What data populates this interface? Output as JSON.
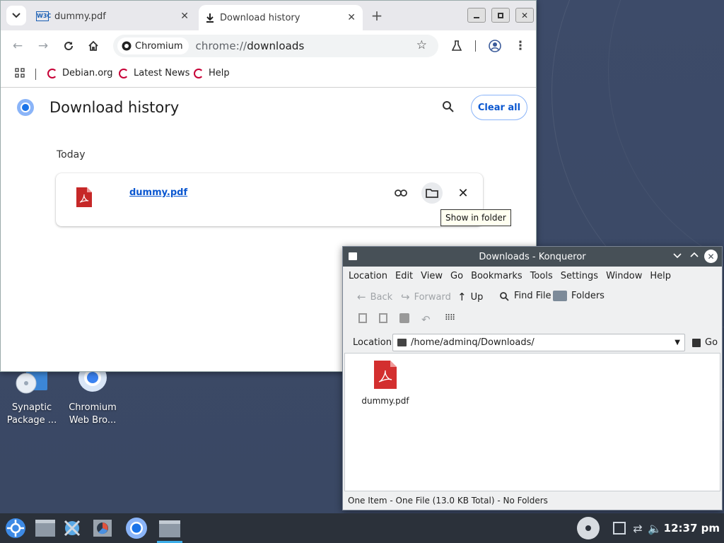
{
  "chrome": {
    "tabs": [
      {
        "label": "dummy.pdf",
        "favicon": "w3c-icon"
      },
      {
        "label": "Download history",
        "favicon": "download-icon"
      }
    ],
    "omnibox": {
      "chip": "Chromium",
      "url_scheme": "chrome://",
      "url_path": "downloads"
    },
    "bookmarks": [
      "Debian.org",
      "Latest News",
      "Help"
    ],
    "page": {
      "title": "Download history",
      "clear_all": "Clear all",
      "section": "Today",
      "item": {
        "filename": "dummy.pdf"
      },
      "tooltip": "Show in folder"
    }
  },
  "desktop_icons": [
    {
      "label": "Synaptic Package ..."
    },
    {
      "label": "Chromium Web Bro..."
    }
  ],
  "konqueror": {
    "title": "Downloads - Konqueror",
    "menu": [
      "Location",
      "Edit",
      "View",
      "Go",
      "Bookmarks",
      "Tools",
      "Settings",
      "Window",
      "Help"
    ],
    "toolbar": {
      "back": "Back",
      "forward": "Forward",
      "up": "Up",
      "find": "Find File",
      "folders": "Folders"
    },
    "location_label": "Location:",
    "location_value": "/home/adminq/Downloads/",
    "go": "Go",
    "file": "dummy.pdf",
    "status": "One Item - One File (13.0 KB Total) - No Folders"
  },
  "taskbar": {
    "clock": "12:37 pm"
  },
  "colors": {
    "accent": "#0b57d0",
    "pdf_red": "#d32f2f",
    "konq_title": "#475057",
    "taskbar": "#2b313a"
  }
}
